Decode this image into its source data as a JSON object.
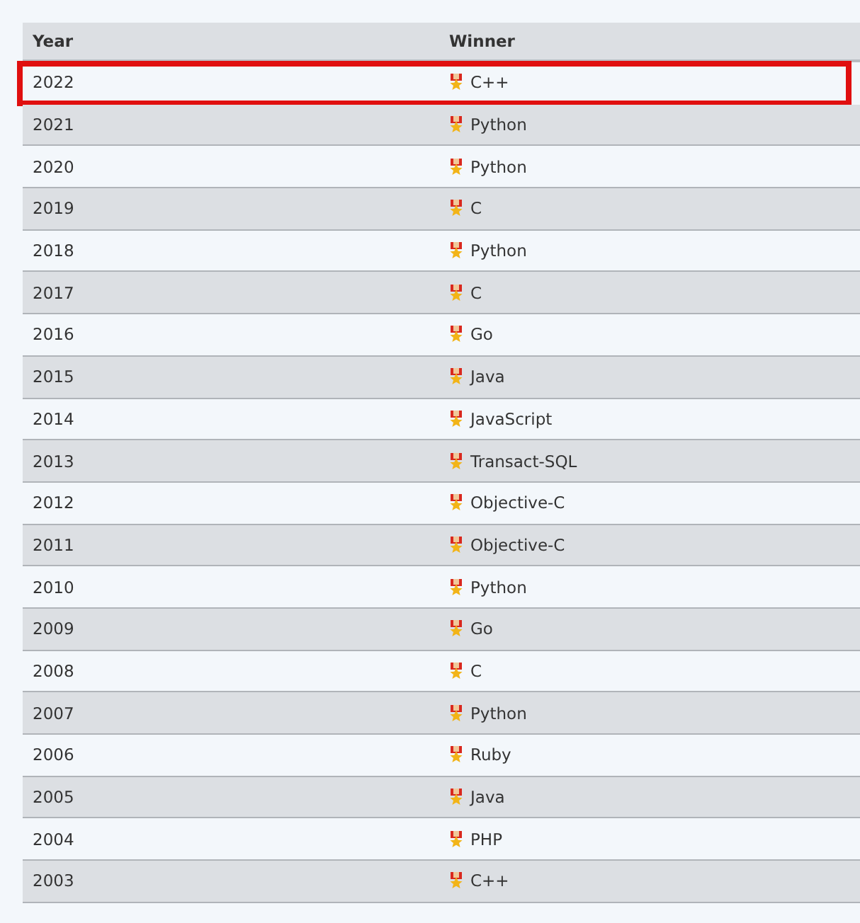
{
  "table": {
    "columns": [
      "Year",
      "Winner"
    ],
    "rows": [
      {
        "year": "2022",
        "winner": "C++",
        "highlighted": true
      },
      {
        "year": "2021",
        "winner": "Python",
        "highlighted": false
      },
      {
        "year": "2020",
        "winner": "Python",
        "highlighted": false
      },
      {
        "year": "2019",
        "winner": "C",
        "highlighted": false
      },
      {
        "year": "2018",
        "winner": "Python",
        "highlighted": false
      },
      {
        "year": "2017",
        "winner": "C",
        "highlighted": false
      },
      {
        "year": "2016",
        "winner": "Go",
        "highlighted": false
      },
      {
        "year": "2015",
        "winner": "Java",
        "highlighted": false
      },
      {
        "year": "2014",
        "winner": "JavaScript",
        "highlighted": false
      },
      {
        "year": "2013",
        "winner": "Transact-SQL",
        "highlighted": false
      },
      {
        "year": "2012",
        "winner": "Objective-C",
        "highlighted": false
      },
      {
        "year": "2011",
        "winner": "Objective-C",
        "highlighted": false
      },
      {
        "year": "2010",
        "winner": "Python",
        "highlighted": false
      },
      {
        "year": "2009",
        "winner": "Go",
        "highlighted": false
      },
      {
        "year": "2008",
        "winner": "C",
        "highlighted": false
      },
      {
        "year": "2007",
        "winner": "Python",
        "highlighted": false
      },
      {
        "year": "2006",
        "winner": "Ruby",
        "highlighted": false
      },
      {
        "year": "2005",
        "winner": "Java",
        "highlighted": false
      },
      {
        "year": "2004",
        "winner": "PHP",
        "highlighted": false
      },
      {
        "year": "2003",
        "winner": "C++",
        "highlighted": false
      }
    ]
  }
}
